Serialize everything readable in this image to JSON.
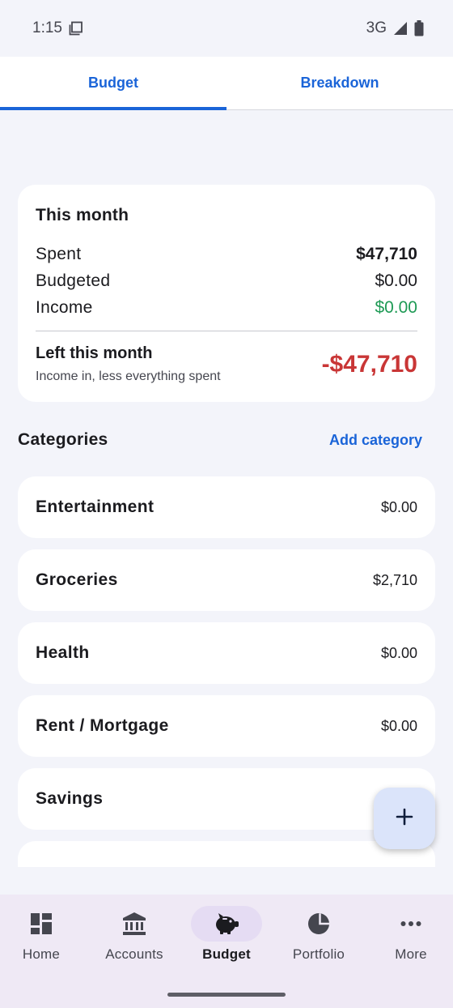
{
  "status_bar": {
    "time": "1:15",
    "network": "3G",
    "icons": [
      "screenshot-icon",
      "signal-icon",
      "battery-icon"
    ]
  },
  "tabs": [
    {
      "label": "Budget",
      "active": true
    },
    {
      "label": "Breakdown",
      "active": false
    }
  ],
  "summary": {
    "title": "This month",
    "spent_label": "Spent",
    "spent_value": "$47,710",
    "budgeted_label": "Budgeted",
    "budgeted_value": "$0.00",
    "income_label": "Income",
    "income_value": "$0.00",
    "left_title": "Left this month",
    "left_subtitle": "Income in, less everything spent",
    "left_value": "-$47,710"
  },
  "categories": {
    "title": "Categories",
    "add_label": "Add category",
    "items": [
      {
        "name": "Entertainment",
        "amount": "$0.00"
      },
      {
        "name": "Groceries",
        "amount": "$2,710"
      },
      {
        "name": "Health",
        "amount": "$0.00"
      },
      {
        "name": "Rent / Mortgage",
        "amount": "$0.00"
      },
      {
        "name": "Savings",
        "amount": ""
      }
    ]
  },
  "fab": {
    "icon": "plus-icon"
  },
  "bottom_nav": [
    {
      "label": "Home",
      "icon": "dashboard-icon",
      "active": false
    },
    {
      "label": "Accounts",
      "icon": "bank-icon",
      "active": false
    },
    {
      "label": "Budget",
      "icon": "piggy-bank-icon",
      "active": true
    },
    {
      "label": "Portfolio",
      "icon": "pie-chart-icon",
      "active": false
    },
    {
      "label": "More",
      "icon": "more-dots-icon",
      "active": false
    }
  ],
  "colors": {
    "accent": "#1a64d8",
    "negative": "#c93636",
    "positive": "#1e9a55",
    "background": "#f3f4fa",
    "nav_background": "#efe9f5"
  }
}
